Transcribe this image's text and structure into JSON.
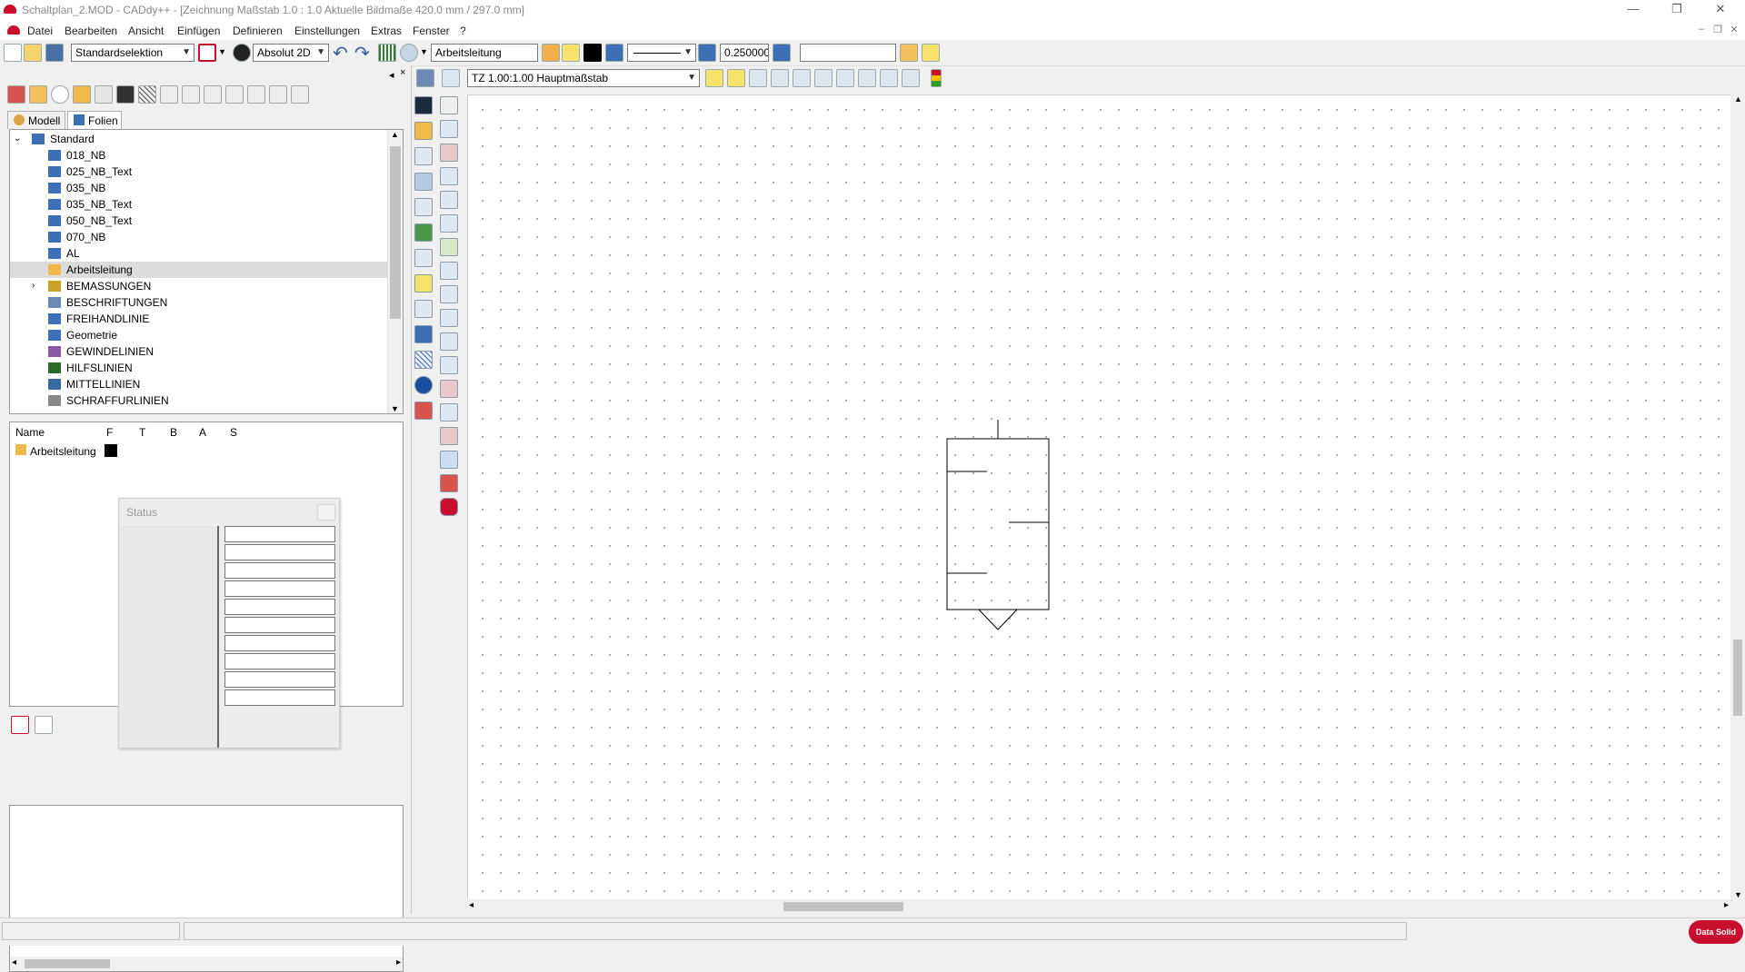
{
  "window": {
    "title": "Schaltplan_2.MOD  -  CADdy++ - [Zeichnung   Maßstab 1.0 : 1.0   Aktuelle Bildmaße 420.0 mm / 297.0 mm]",
    "minimize": "—",
    "restore": "❐",
    "close": "✕",
    "mdi_minimize": "–",
    "mdi_restore": "❐",
    "mdi_close": "✕"
  },
  "menu": [
    "Datei",
    "Bearbeiten",
    "Ansicht",
    "Einfügen",
    "Definieren",
    "Einstellungen",
    "Extras",
    "Fenster",
    "?"
  ],
  "toolbar": {
    "selection_mode": "Standardselektion",
    "coord_mode": "Absolut 2D",
    "layer": "Arbeitsleitung",
    "line_width": "0.250000",
    "search_value": "",
    "line_color": "#000000"
  },
  "view_toolbar": {
    "scale": "TZ 1.00:1.00 Hauptmaßstab"
  },
  "tabs": [
    {
      "label": "Modell"
    },
    {
      "label": "Folien"
    }
  ],
  "tree": {
    "root": "Standard",
    "items": [
      {
        "label": "018_NB",
        "icon": "layer-stack-icon"
      },
      {
        "label": "025_NB_Text",
        "icon": "layer-stack-icon"
      },
      {
        "label": "035_NB",
        "icon": "layer-stack-icon"
      },
      {
        "label": "035_NB_Text",
        "icon": "layer-stack-icon"
      },
      {
        "label": "050_NB_Text",
        "icon": "layer-stack-icon"
      },
      {
        "label": "070_NB",
        "icon": "layer-stack-icon"
      },
      {
        "label": "AL",
        "icon": "layer-stack-icon"
      },
      {
        "label": "Arbeitsleitung",
        "icon": "pencil-icon",
        "selected": true
      },
      {
        "label": "BEMASSUNGEN",
        "icon": "dimension-icon",
        "expandable": true
      },
      {
        "label": "BESCHRIFTUNGEN",
        "icon": "text-edit-icon"
      },
      {
        "label": "FREIHANDLINIE",
        "icon": "layer-stack-icon"
      },
      {
        "label": "Geometrie",
        "icon": "layer-stack-icon"
      },
      {
        "label": "GEWINDELINIEN",
        "icon": "thread-line-icon"
      },
      {
        "label": "HILFSLINIEN",
        "icon": "helper-line-icon"
      },
      {
        "label": "MITTELLINIEN",
        "icon": "center-line-icon"
      },
      {
        "label": "SCHRAFFURLINIEN",
        "icon": "hatch-icon"
      }
    ]
  },
  "properties": {
    "columns": [
      "Name",
      "F",
      "T",
      "B",
      "A",
      "S"
    ],
    "row": {
      "name": "Arbeitsleitung",
      "color": "#000000"
    }
  },
  "status_popup": {
    "title": "Status",
    "close": "×",
    "rows": 10
  },
  "colors": {
    "accent_red": "#c8102e",
    "selection_bg": "#dcdcdc"
  },
  "brand": "Data Solid"
}
